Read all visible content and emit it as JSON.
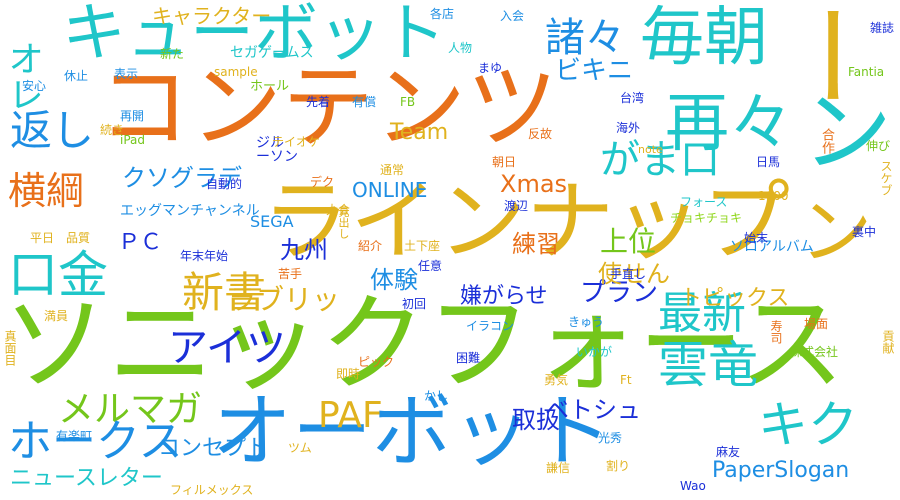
{
  "palette": {
    "orange": "#e8701a",
    "yellow": "#e0b21e",
    "green": "#74c61b",
    "teal": "#1fc6c9",
    "blue": "#1e8ee3",
    "navy": "#1b2fd8",
    "lime": "#8fd61c",
    "gold": "#d9a81c",
    "cyan": "#19b8e6"
  },
  "words": [
    {
      "text": "ソニックフォース"
    },
    {
      "text": "コンテンツ"
    },
    {
      "text": "ラインナップ"
    },
    {
      "text": "オーボット"
    },
    {
      "text": "キューボット"
    },
    {
      "text": "毎朝"
    },
    {
      "text": "再々"
    },
    {
      "text": "雲竜"
    },
    {
      "text": "最新"
    },
    {
      "text": "キク"
    },
    {
      "text": "口金"
    },
    {
      "text": "横綱"
    },
    {
      "text": "返し"
    },
    {
      "text": "新書"
    },
    {
      "text": "PAF"
    },
    {
      "text": "メルマガ"
    },
    {
      "text": "ホークス"
    },
    {
      "text": "アイツ"
    },
    {
      "text": "諸々"
    },
    {
      "text": "がま口"
    },
    {
      "text": "ラブリッ"
    },
    {
      "text": "クソグラデ"
    },
    {
      "text": "PaperSlogan"
    },
    {
      "text": "ベトシュ"
    },
    {
      "text": "オレ"
    },
    {
      "text": "ビキニ"
    },
    {
      "text": "Team"
    },
    {
      "text": "Xmas"
    },
    {
      "text": "ONLINE"
    },
    {
      "text": "プラン"
    },
    {
      "text": "上位"
    },
    {
      "text": "練習"
    },
    {
      "text": "体験"
    },
    {
      "text": "九州"
    },
    {
      "text": "嫌がらせ"
    },
    {
      "text": "使せん"
    },
    {
      "text": "トピックス"
    },
    {
      "text": "取扱"
    },
    {
      "text": "コンセプト"
    },
    {
      "text": "ニュースレター"
    },
    {
      "text": "キャラクター"
    },
    {
      "text": "セガゲームス"
    },
    {
      "text": "ソロアルバム"
    },
    {
      "text": "チョキチョキ"
    },
    {
      "text": "エッグマンチャンネル"
    },
    {
      "text": "フォース"
    },
    {
      "text": "ＰＣ"
    },
    {
      "text": "SEGA"
    },
    {
      "text": "フィルメックス"
    },
    {
      "text": "ー"
    },
    {
      "text": "ン"
    },
    {
      "text": "ン"
    },
    {
      "text": "ツム"
    },
    {
      "text": "ホール"
    },
    {
      "text": "sample"
    },
    {
      "text": "Fantia"
    },
    {
      "text": "各店"
    },
    {
      "text": "入会"
    },
    {
      "text": "人物"
    },
    {
      "text": "まゆ"
    },
    {
      "text": "雑誌"
    },
    {
      "text": "新た"
    },
    {
      "text": "休止"
    },
    {
      "text": "安心"
    },
    {
      "text": "表示"
    },
    {
      "text": "再開"
    },
    {
      "text": "先着"
    },
    {
      "text": "有償"
    },
    {
      "text": "FB"
    },
    {
      "text": "台湾"
    },
    {
      "text": "続き"
    },
    {
      "text": "iPad"
    },
    {
      "text": "反故"
    },
    {
      "text": "海外"
    },
    {
      "text": "合作"
    },
    {
      "text": "伸び"
    },
    {
      "text": "ジル"
    },
    {
      "text": "テイオケ"
    },
    {
      "text": "ーソン"
    },
    {
      "text": "通常"
    },
    {
      "text": "note"
    },
    {
      "text": "日馬"
    },
    {
      "text": "スケブ"
    },
    {
      "text": "朝日"
    },
    {
      "text": "自動的"
    },
    {
      "text": "デク"
    },
    {
      "text": "大会"
    },
    {
      "text": "渡辺"
    },
    {
      "text": "1600"
    },
    {
      "text": "平日"
    },
    {
      "text": "品質"
    },
    {
      "text": "見出し"
    },
    {
      "text": "紹介"
    },
    {
      "text": "土下座"
    },
    {
      "text": "始末"
    },
    {
      "text": "裏中"
    },
    {
      "text": "年末年始"
    },
    {
      "text": "苦手"
    },
    {
      "text": "任意"
    },
    {
      "text": "手直し"
    },
    {
      "text": "初回"
    },
    {
      "text": "満員"
    },
    {
      "text": "イラコン"
    },
    {
      "text": "きゅう"
    },
    {
      "text": "寿司"
    },
    {
      "text": "場面"
    },
    {
      "text": "株式会社"
    },
    {
      "text": "貢献"
    },
    {
      "text": "いかが"
    },
    {
      "text": "ピック"
    },
    {
      "text": "困難"
    },
    {
      "text": "真面目"
    },
    {
      "text": "即時"
    },
    {
      "text": "勇気"
    },
    {
      "text": "かし"
    },
    {
      "text": "光秀"
    },
    {
      "text": "麻友"
    },
    {
      "text": "有楽町"
    },
    {
      "text": "謙信"
    },
    {
      "text": "割り"
    },
    {
      "text": "Wao"
    },
    {
      "text": "Ft"
    }
  ]
}
